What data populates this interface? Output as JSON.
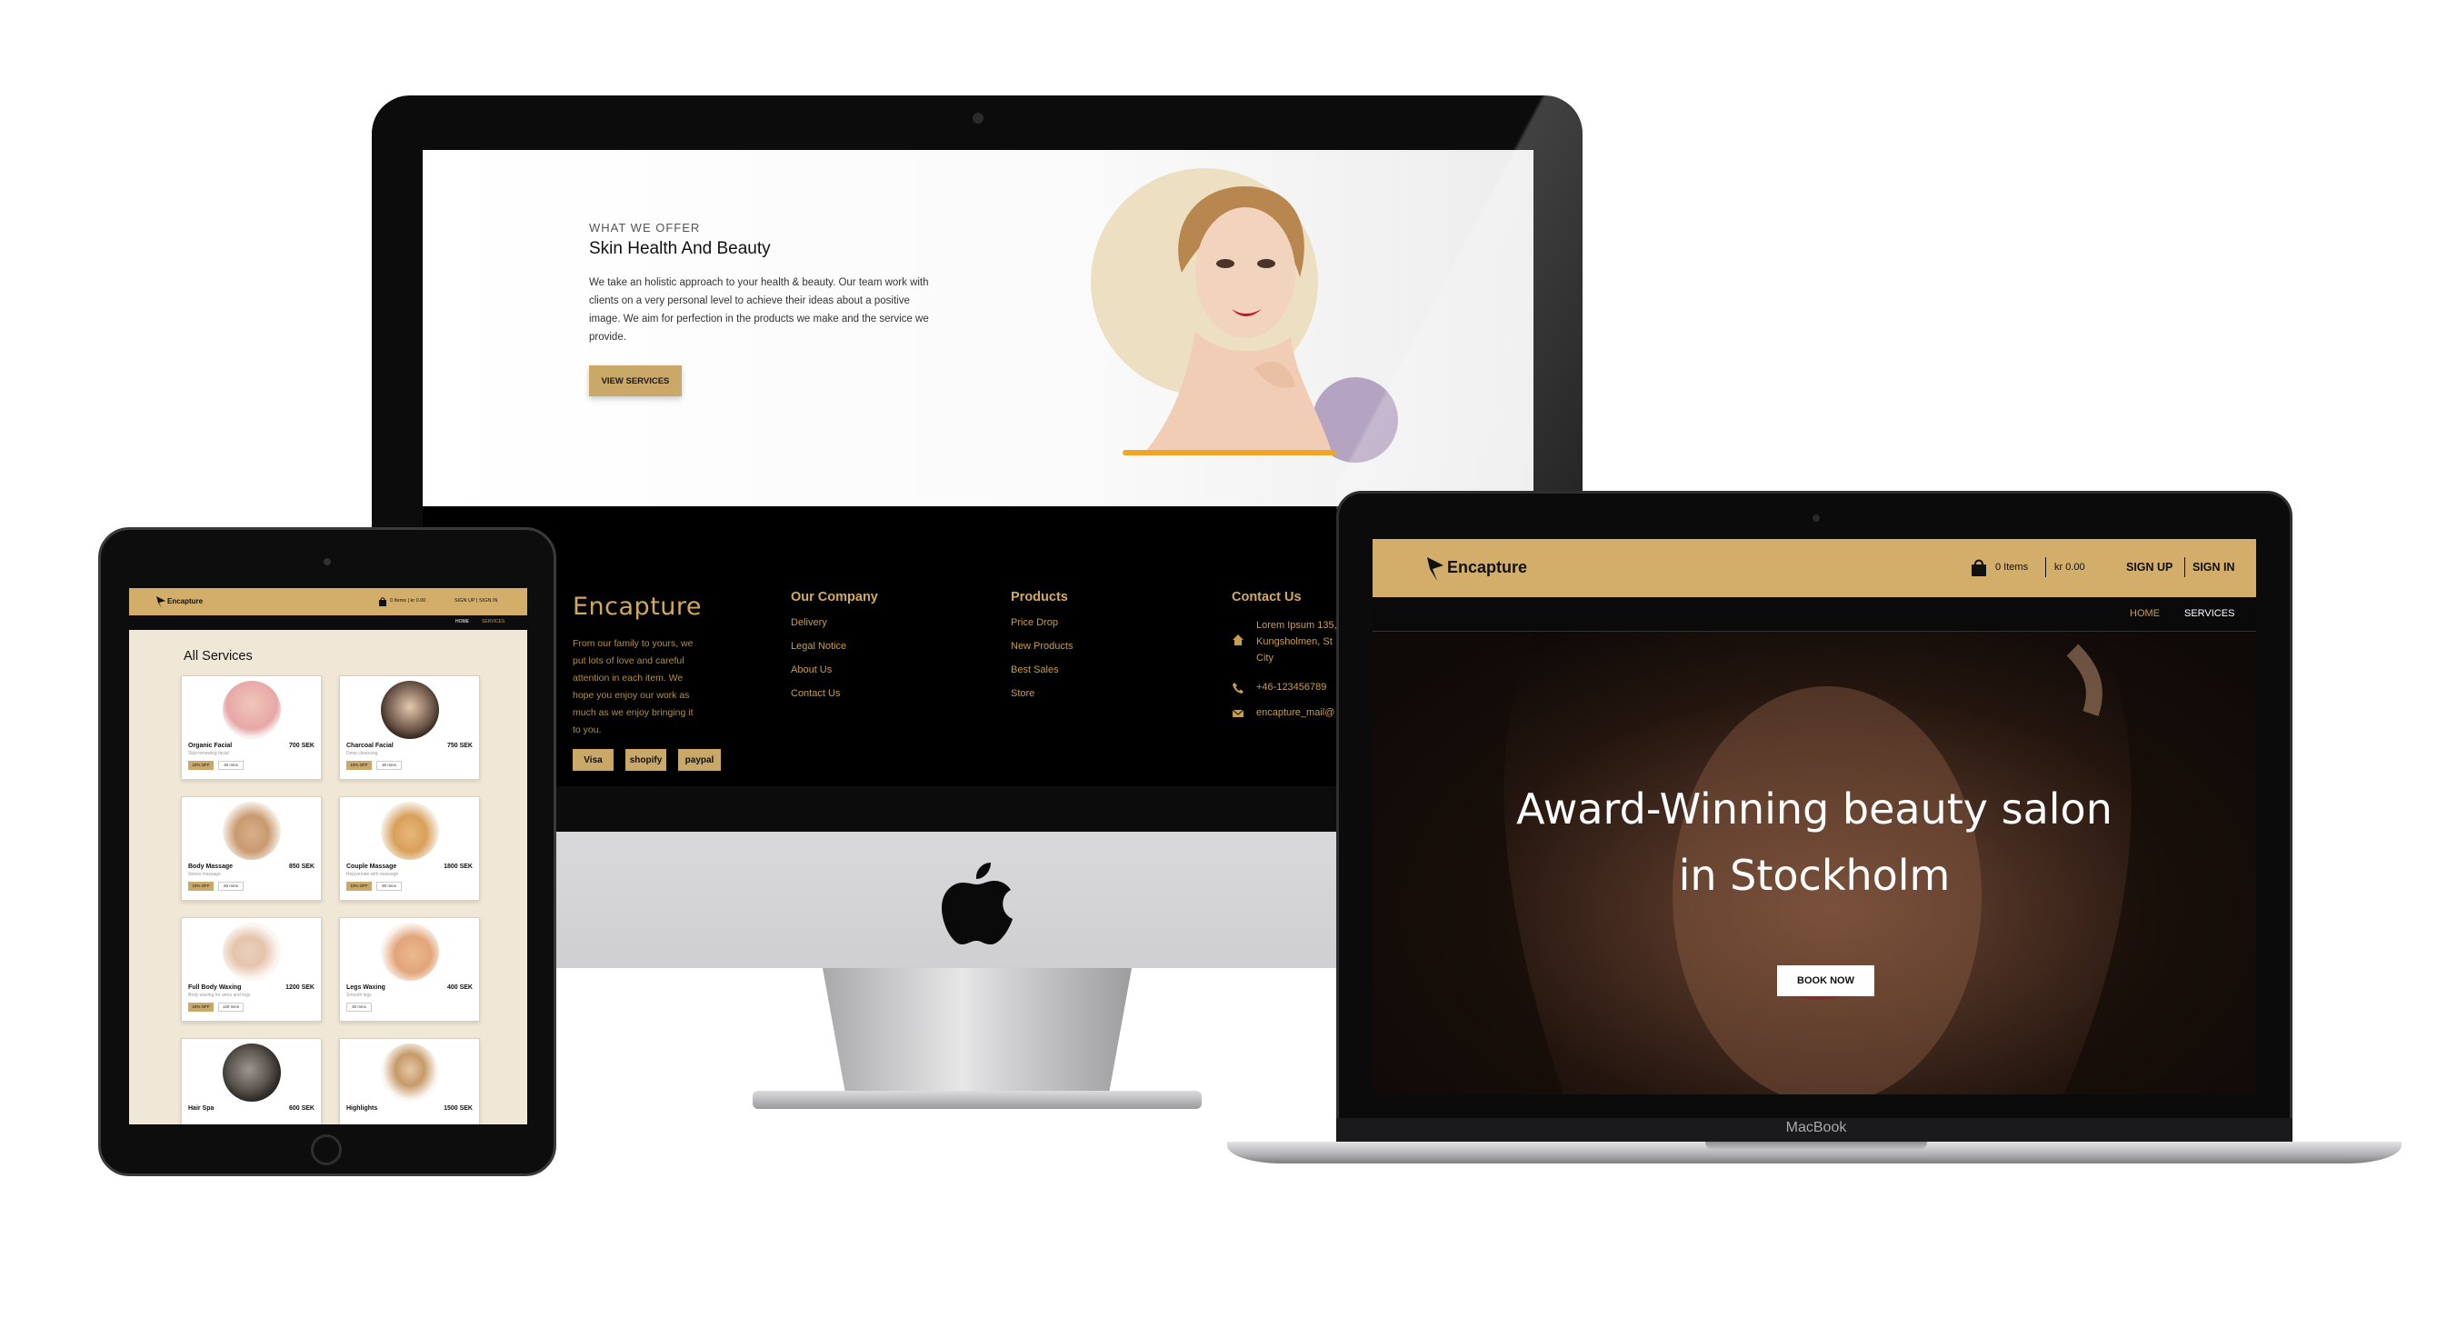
{
  "imac": {
    "offer": {
      "eyebrow": "WHAT WE OFFER",
      "title": "Skin Health And Beauty",
      "text": "We take an holistic approach to your health & beauty. Our team work with clients on a very personal level to achieve their ideas about a positive image. We aim for perfection in the products we make and the service we provide.",
      "button": "VIEW SERVICES"
    },
    "footer": {
      "brand": "Encapture",
      "about": "From our family to yours, we put lots of love and careful attention in each item. We hope you enjoy our work as much as we enjoy bringing it to you.",
      "payments": [
        "Visa",
        "shopify",
        "paypal"
      ],
      "company": {
        "title": "Our Company",
        "links": [
          "Delivery",
          "Legal Notice",
          "About Us",
          "Contact Us"
        ]
      },
      "products": {
        "title": "Products",
        "links": [
          "Price Drop",
          "New Products",
          "Best Sales",
          "Store"
        ]
      },
      "contact": {
        "title": "Contact Us",
        "address": "Lorem Ipsum 135, Kungsholmen, St City",
        "phone": "+46-123456789",
        "email": "encapture_mail@"
      }
    }
  },
  "ipad": {
    "brand": "Encapture",
    "cart": "0 Items  |  kr 0.00",
    "auth": "SIGN UP  |  SIGN IN",
    "nav": [
      "HOME",
      "SERVICES"
    ],
    "title": "All Services",
    "services": [
      {
        "name": "Organic Facial",
        "price": "700 SEK",
        "desc": "Skin-renewing facial",
        "tag": "10% OFF",
        "time": "30 mins",
        "color": "#e8a7a8"
      },
      {
        "name": "Charcoal Facial",
        "price": "750 SEK",
        "desc": "Deep cleansing",
        "tag": "10% OFF",
        "time": "30 mins",
        "color": "#6a5446"
      },
      {
        "name": "Body Massage",
        "price": "850 SEK",
        "desc": "Stress massage",
        "tag": "10% OFF",
        "time": "60 mins",
        "color": "#c99a70"
      },
      {
        "name": "Couple Massage",
        "price": "1800 SEK",
        "desc": "Rejuvenate with massage",
        "tag": "10% OFF",
        "time": "90 mins",
        "color": "#d8a05a"
      },
      {
        "name": "Full Body Waxing",
        "price": "1200 SEK",
        "desc": "Body waxing for arms and legs",
        "tag": "10% OFF",
        "time": "120 mins",
        "color": "#e6c4ac"
      },
      {
        "name": "Legs Waxing",
        "price": "400 SEK",
        "desc": "Smooth legs",
        "tag": "",
        "time": "30 mins",
        "color": "#e2a57a"
      },
      {
        "name": "Hair Spa",
        "price": "600 SEK",
        "desc": "",
        "tag": "",
        "time": "",
        "color": "#5c5550"
      },
      {
        "name": "Highlights",
        "price": "1500 SEK",
        "desc": "",
        "tag": "",
        "time": "",
        "color": "#c69a6a"
      }
    ]
  },
  "macbook": {
    "label": "MacBook",
    "brand": "Encapture",
    "cart_items": "0 Items",
    "cart_total": "kr 0.00",
    "sign_up": "SIGN UP",
    "sign_in": "SIGN IN",
    "nav": [
      "HOME",
      "SERVICES"
    ],
    "hero_title_1": "Award-Winning beauty salon",
    "hero_title_2": "in Stockholm",
    "hero_button": "BOOK NOW"
  },
  "colors": {
    "gold": "#d2ae6a",
    "gold_text": "#c89d4e",
    "black": "#000000"
  }
}
